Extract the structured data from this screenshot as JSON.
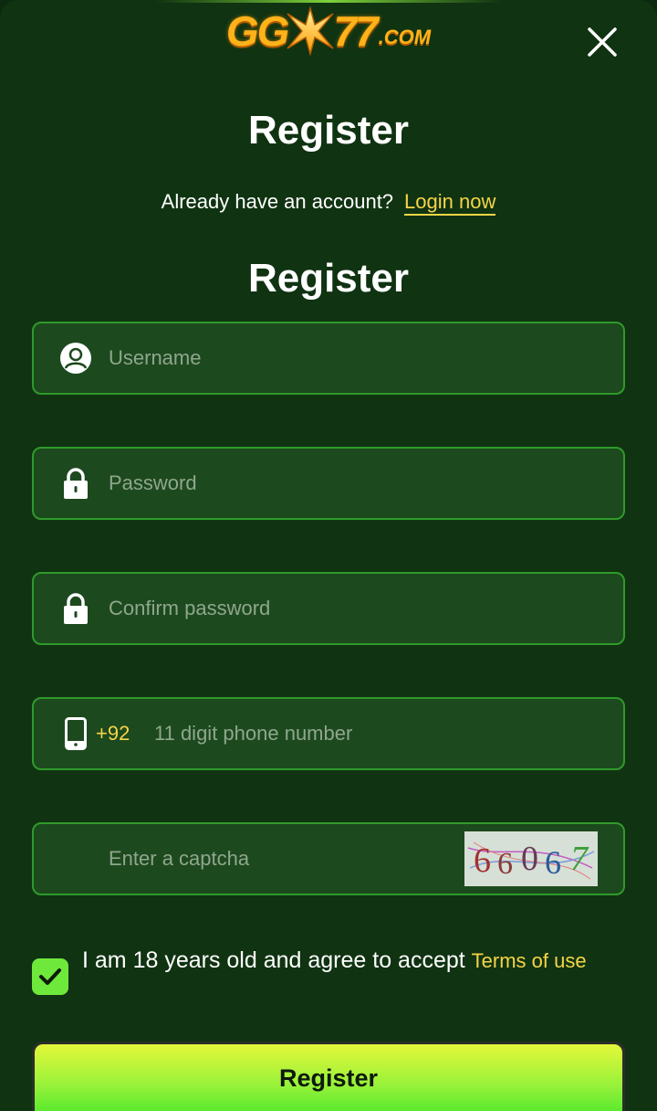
{
  "logo": {
    "main": "GG",
    "after": "77",
    "suffix": ".COM"
  },
  "header": {
    "title": "Register",
    "account_prompt": "Already have an account?",
    "login_link": "Login now",
    "form_title": "Register"
  },
  "form": {
    "username_placeholder": "Username",
    "password_placeholder": "Password",
    "confirm_placeholder": "Confirm password",
    "phone_prefix": "+92",
    "phone_placeholder": "11 digit phone number",
    "captcha_placeholder": "Enter a captcha",
    "captcha_code": [
      "6",
      "6",
      "0",
      "6",
      "7"
    ]
  },
  "agree": {
    "text": "I am 18 years old and agree to accept",
    "terms_link": "Terms of use",
    "checked": true
  },
  "submit_label": "Register",
  "colors": {
    "background": "#103312",
    "field_bg": "#1d491e",
    "field_border": "#2f9a2a",
    "accent_yellow": "#f5d547",
    "checkbox_green": "#6fe83c",
    "logo_gold": "#ffb21a"
  },
  "icons": {
    "close": "close-icon",
    "username": "user-circle-icon",
    "password": "lock-icon",
    "phone": "phone-icon",
    "check": "checkmark-icon",
    "logo_star": "star-icon"
  }
}
